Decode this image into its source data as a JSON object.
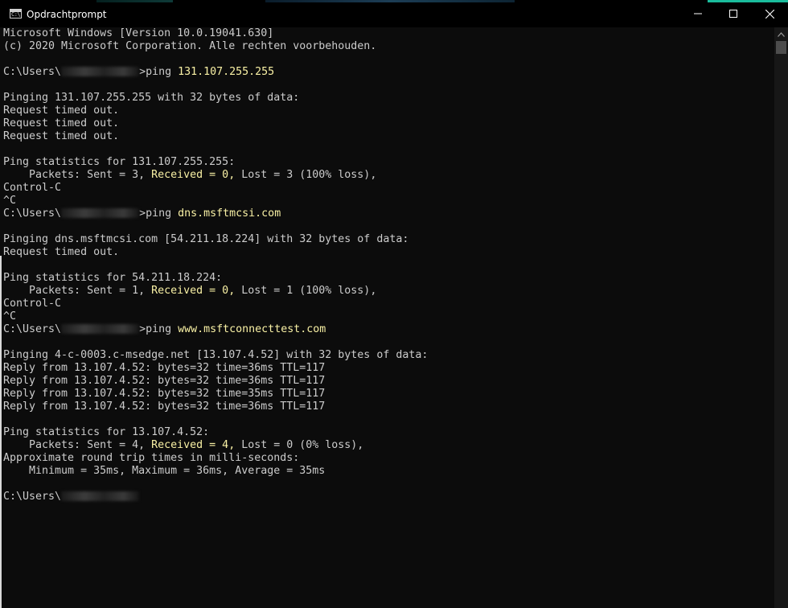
{
  "window": {
    "title": "Opdrachtprompt",
    "icon": "cmd-icon",
    "buttons": {
      "minimize_icon": "minimize-icon",
      "maximize_icon": "maximize-icon",
      "close_icon": "close-icon"
    }
  },
  "colors": {
    "background": "#0c0c0c",
    "text": "#cccccc",
    "highlight": "#f9f1a5",
    "scrollbar_thumb": "#4d4d4d"
  },
  "console": {
    "lines": [
      {
        "text": "Microsoft Windows [Version 10.0.19041.630]"
      },
      {
        "text": "(c) 2020 Microsoft Corporation. Alle rechten voorbehouden."
      },
      {
        "text": ""
      },
      {
        "prefix": "C:\\Users\\",
        "suffix": ">ping ",
        "cmd": "131.107.255.255"
      },
      {
        "text": ""
      },
      {
        "text": "Pinging 131.107.255.255 with 32 bytes of data:"
      },
      {
        "text": "Request timed out."
      },
      {
        "text": "Request timed out."
      },
      {
        "text": "Request timed out."
      },
      {
        "text": ""
      },
      {
        "text": "Ping statistics for 131.107.255.255:"
      },
      {
        "pre": "    Packets: Sent = 3, ",
        "hl": "Received = 0,",
        "post": " Lost = 3 (100% loss),"
      },
      {
        "text": "Control-C"
      },
      {
        "text": "^C"
      },
      {
        "prefix": "C:\\Users\\",
        "suffix": ">ping ",
        "cmd": "dns.msftmcsi.com"
      },
      {
        "text": ""
      },
      {
        "text": "Pinging dns.msftmcsi.com [54.211.18.224] with 32 bytes of data:"
      },
      {
        "text": "Request timed out."
      },
      {
        "text": ""
      },
      {
        "text": "Ping statistics for 54.211.18.224:"
      },
      {
        "pre": "    Packets: Sent = 1, ",
        "hl": "Received = 0,",
        "post": " Lost = 1 (100% loss),"
      },
      {
        "text": "Control-C"
      },
      {
        "text": "^C"
      },
      {
        "prefix": "C:\\Users\\",
        "suffix": ">ping ",
        "cmd": "www.msftconnecttest.com"
      },
      {
        "text": ""
      },
      {
        "text": "Pinging 4-c-0003.c-msedge.net [13.107.4.52] with 32 bytes of data:"
      },
      {
        "text": "Reply from 13.107.4.52: bytes=32 time=36ms TTL=117"
      },
      {
        "text": "Reply from 13.107.4.52: bytes=32 time=36ms TTL=117"
      },
      {
        "text": "Reply from 13.107.4.52: bytes=32 time=35ms TTL=117"
      },
      {
        "text": "Reply from 13.107.4.52: bytes=32 time=36ms TTL=117"
      },
      {
        "text": ""
      },
      {
        "text": "Ping statistics for 13.107.4.52:"
      },
      {
        "pre": "    Packets: Sent = 4, ",
        "hl": "Received = 4,",
        "post": " Lost = 0 (0% loss),"
      },
      {
        "text": "Approximate round trip times in milli-seconds:"
      },
      {
        "text": "    Minimum = 35ms, Maximum = 36ms, Average = 35ms"
      },
      {
        "text": ""
      },
      {
        "prefix": "C:\\Users\\",
        "suffix": "",
        "cmd": ""
      }
    ]
  }
}
